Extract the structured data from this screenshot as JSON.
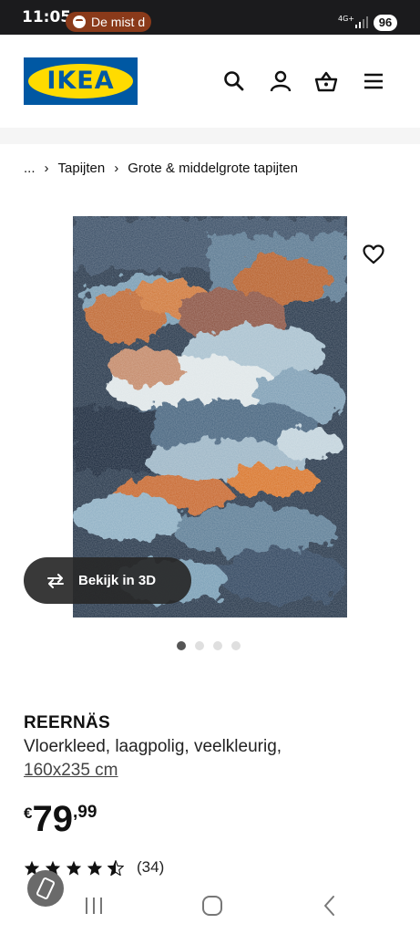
{
  "status": {
    "time": "11:05",
    "media_text": "De mist d",
    "network": "4G+",
    "battery": "96"
  },
  "header": {
    "logo_text": "IKEA",
    "icons": [
      "search-icon",
      "account-icon",
      "basket-icon",
      "menu-icon"
    ]
  },
  "breadcrumb": {
    "ellipsis": "...",
    "items": [
      "Tapijten",
      "Grote & middelgrote tapijten"
    ]
  },
  "gallery": {
    "view_3d_label": "Bekijk in 3D",
    "dot_count": 4,
    "active_dot": 0
  },
  "product": {
    "name": "REERNÄS",
    "description": "Vloerkleed, laagpolig, veelkleurig,",
    "size": "160x235 cm",
    "price_currency": "€",
    "price_integer": "79",
    "price_decimal": ",99",
    "rating": 4.5,
    "review_count": "(34)"
  },
  "colors": {
    "ikea_blue": "#0058a3",
    "ikea_yellow": "#ffdb00",
    "status_bg": "#1b1b1d",
    "text": "#111111"
  }
}
